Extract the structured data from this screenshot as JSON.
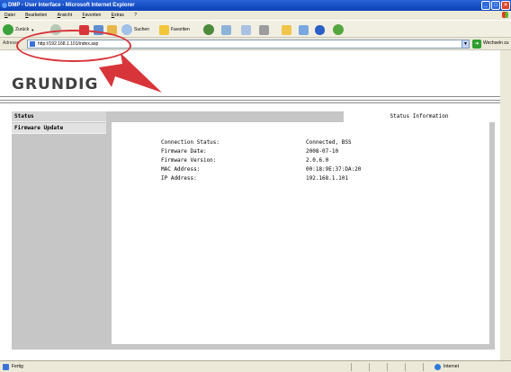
{
  "window": {
    "title": "DMP - User Interface - Microsoft Internet Explorer"
  },
  "menu": [
    "Datei",
    "Bearbeiten",
    "Ansicht",
    "Favoriten",
    "Extras",
    "?"
  ],
  "toolbar": {
    "back_label": "Zurück",
    "search_label": "Suchen",
    "favorites_label": "Favoriten"
  },
  "address": {
    "label": "Adresse",
    "url": "http://192.168.1.101/index.asp",
    "go_label": "Wechseln zu"
  },
  "brand": {
    "logo": "GRUNDIG"
  },
  "sidebar": {
    "items": [
      {
        "label": "Status"
      },
      {
        "label": "Firmware Update"
      }
    ]
  },
  "content": {
    "tab_label": "Status Information",
    "rows": [
      {
        "label": "Connection Status:",
        "value": "Connected, BSS"
      },
      {
        "label": "Firmware Date:",
        "value": "2008-07-10"
      },
      {
        "label": "Firmware Version:",
        "value": "2.0.6.0"
      },
      {
        "label": "MAC Address:",
        "value": "00:18:9E:37:DA:20"
      },
      {
        "label": "IP Address:",
        "value": "192.168.1.101"
      }
    ]
  },
  "statusbar": {
    "left_text": "Fertig",
    "zone": "Internet"
  },
  "colors": {
    "accent": "#d8353a",
    "titlebar": "#0a3fb8"
  }
}
